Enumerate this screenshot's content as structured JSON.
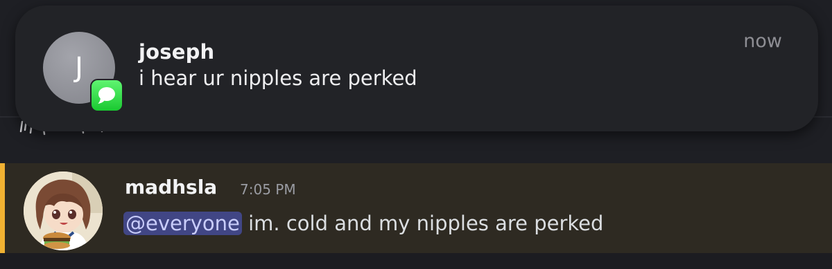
{
  "notification": {
    "avatar_initial": "J",
    "app_icon": "messages-icon",
    "sender": "joseph",
    "body": "i hear ur nipples are perked",
    "time": "now"
  },
  "message": {
    "author": "madhsla",
    "timestamp": "7:05 PM",
    "mention": "@everyone",
    "text": " im. cold and my nipples are perked",
    "accent_color": "#f0b132",
    "mention_bg": "#414685"
  }
}
